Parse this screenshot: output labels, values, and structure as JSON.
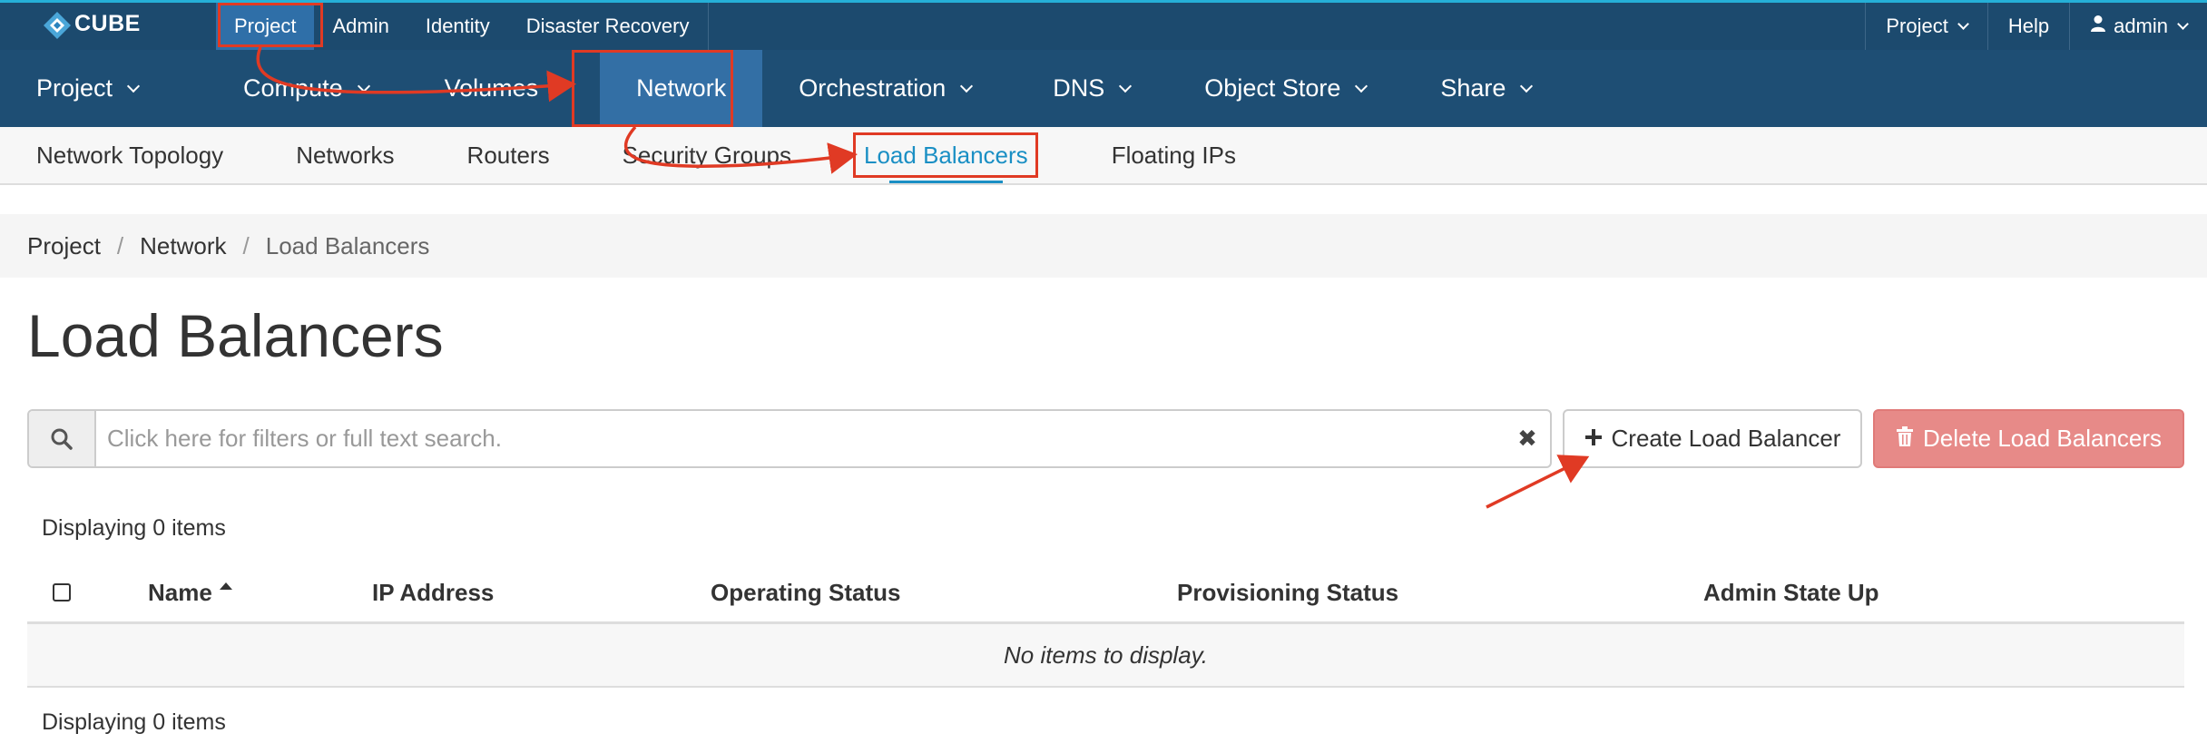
{
  "brand": {
    "name": "CUBE"
  },
  "topbar": {
    "left_items": [
      "Project",
      "Admin",
      "Identity",
      "Disaster Recovery"
    ],
    "active_left": "Project",
    "project_menu": "Project",
    "help": "Help",
    "user": "admin"
  },
  "mainnav": {
    "items": [
      "Project",
      "Compute",
      "Volumes",
      "Network",
      "Orchestration",
      "DNS",
      "Object Store",
      "Share"
    ],
    "active": "Network"
  },
  "subnav": {
    "items": [
      "Network Topology",
      "Networks",
      "Routers",
      "Security Groups",
      "Load Balancers",
      "Floating IPs"
    ],
    "active": "Load Balancers"
  },
  "breadcrumb": {
    "items": [
      "Project",
      "Network",
      "Load Balancers"
    ],
    "divider": "/"
  },
  "page": {
    "title": "Load Balancers",
    "search_placeholder": "Click here for filters or full text search.",
    "create_button": "Create Load Balancer",
    "delete_button": "Delete Load Balancers",
    "display_count_top": "Displaying 0 items",
    "display_count_bottom": "Displaying 0 items"
  },
  "table": {
    "columns": [
      "Name",
      "IP Address",
      "Operating Status",
      "Provisioning Status",
      "Admin State Up"
    ],
    "sorted_column": "Name",
    "empty_message": "No items to display."
  },
  "colors": {
    "topbar": "#1c4a6e",
    "mainnav": "#1e4e74",
    "active_nav": "#336fa5",
    "link": "#1a8fc4",
    "danger": "#e78a88",
    "annotation": "#e03a24"
  },
  "icons": {
    "search": "search-icon",
    "clear": "clear-icon",
    "plus": "plus-icon",
    "trash": "trash-icon",
    "user": "user-icon"
  }
}
